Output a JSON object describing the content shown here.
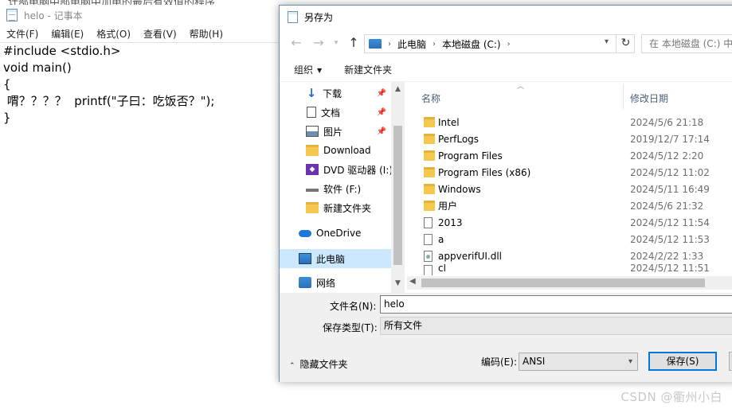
{
  "notepad": {
    "title": "helo - 记事本",
    "menu": [
      "文件(F)",
      "编辑(E)",
      "格式(O)",
      "查看(V)",
      "帮助(H)"
    ],
    "lines": [
      "#include <stdio.h>",
      "void main()",
      "{",
      " 喟？？？？  printf(\"子曰：吃饭否？\");",
      "}"
    ]
  },
  "dialog": {
    "title": "另存为",
    "address": {
      "crumbs": [
        "此电脑",
        "本地磁盘 (C:)"
      ],
      "search_placeholder": "在 本地磁盘 (C:) 中搜"
    },
    "toolbar": {
      "organize": "组织",
      "new_folder": "新建文件夹"
    },
    "tree": [
      {
        "label": "下载",
        "icon": "download-icon",
        "pinned": true
      },
      {
        "label": "文档",
        "icon": "document-icon",
        "pinned": true
      },
      {
        "label": "图片",
        "icon": "picture-icon",
        "pinned": true
      },
      {
        "label": "Download",
        "icon": "folder-icon",
        "pinned": false
      },
      {
        "label": "DVD 驱动器 (I:)",
        "icon": "dvd-drive-icon",
        "pinned": false
      },
      {
        "label": "软件 (F:)",
        "icon": "drive-icon",
        "pinned": false
      },
      {
        "label": "新建文件夹",
        "icon": "folder-icon",
        "pinned": false
      },
      {
        "label": "OneDrive",
        "icon": "onedrive-icon",
        "pinned": false
      },
      {
        "label": "此电脑",
        "icon": "this-pc-icon",
        "pinned": false,
        "selected": true
      },
      {
        "label": "网络",
        "icon": "network-icon",
        "pinned": false
      }
    ],
    "columns": {
      "name": "名称",
      "date": "修改日期"
    },
    "files": [
      {
        "name": "Intel",
        "date": "2024/5/6 21:18",
        "type": "folder"
      },
      {
        "name": "PerfLogs",
        "date": "2019/12/7 17:14",
        "type": "folder"
      },
      {
        "name": "Program Files",
        "date": "2024/5/12 2:20",
        "type": "folder"
      },
      {
        "name": "Program Files (x86)",
        "date": "2024/5/12 11:02",
        "type": "folder"
      },
      {
        "name": "Windows",
        "date": "2024/5/11 16:49",
        "type": "folder"
      },
      {
        "name": "用户",
        "date": "2024/5/6 21:32",
        "type": "folder"
      },
      {
        "name": "2013",
        "date": "2024/5/12 11:54",
        "type": "file"
      },
      {
        "name": "a",
        "date": "2024/5/12 11:53",
        "type": "file"
      },
      {
        "name": "appverifUI.dll",
        "date": "2024/2/22 1:33",
        "type": "dll"
      },
      {
        "name": "cl",
        "date": "2024/5/12 11:51",
        "type": "file"
      }
    ],
    "filename_label": "文件名(N):",
    "filename_value": "helo",
    "filetype_label": "保存类型(T):",
    "filetype_value": "所有文件",
    "hide_folders": "隐藏文件夹",
    "encoding_label": "编码(E):",
    "encoding_value": "ANSI",
    "save_label": "保存(S)"
  },
  "watermark": "CSDN @衢州小白"
}
